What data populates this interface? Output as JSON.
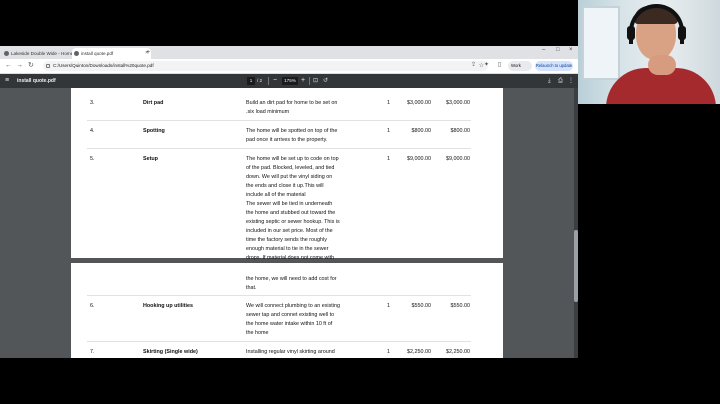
{
  "browser": {
    "tabs": [
      {
        "title": "Lakeside Double Wide - Home"
      },
      {
        "title": "install quote.pdf"
      }
    ],
    "new_tab_symbol": "+",
    "url": "C:/Users/Quinton/Downloads/install%20quote.pdf",
    "profile_label": "Work",
    "relaunch_label": "Relaunch to update"
  },
  "pdf": {
    "file_name": "install quote.pdf",
    "current_page": "1",
    "page_total": "/ 2",
    "zoom": "175%"
  },
  "page1_rows": [
    {
      "num": "3.",
      "name": "Dirt pad",
      "desc": [
        "Build an dirt pad for home to be set on",
        ".six load minimum"
      ],
      "qty": "1",
      "price": "$3,000.00",
      "amount": "$3,000.00"
    },
    {
      "num": "4.",
      "name": "Spotting",
      "desc": [
        "The home will be spotted on top of the",
        "pad once it arrives to the property."
      ],
      "qty": "1",
      "price": "$800.00",
      "amount": "$800.00"
    },
    {
      "num": "5.",
      "name": "Setup",
      "desc": [
        "The home will be set up to code on top",
        "of the pad. Blocked, leveled, and tied",
        "down. We will put the vinyl siding on",
        "the ends and close it up.This will",
        "include all of the material",
        "The sewer will be tied in underneath",
        "the home and stubbed out toward the",
        "existing septic or sewer hookup. This is",
        "included in our set price. Most of the",
        "time the factory sends the roughly",
        "enough material to tie in the sewer",
        "drops. If material does not come with"
      ],
      "qty": "1",
      "price": "$9,000.00",
      "amount": "$9,000.00"
    }
  ],
  "page2_continuation": [
    "the home, we will need to add cost for",
    "that."
  ],
  "page2_rows": [
    {
      "num": "6.",
      "name": "Hooking up utilities",
      "desc": [
        "We will connect plumbing to an existing",
        "sewer tap and connet existing well to",
        "the home water intake within 10 ft of",
        "the home"
      ],
      "qty": "1",
      "price": "$550.00",
      "amount": "$550.00"
    },
    {
      "num": "7.",
      "name": "Skirting (Single wide)",
      "desc": [
        "Installing regular vinyl skirting around"
      ],
      "qty": "1",
      "price": "$2,250.00",
      "amount": "$2,250.00"
    }
  ]
}
